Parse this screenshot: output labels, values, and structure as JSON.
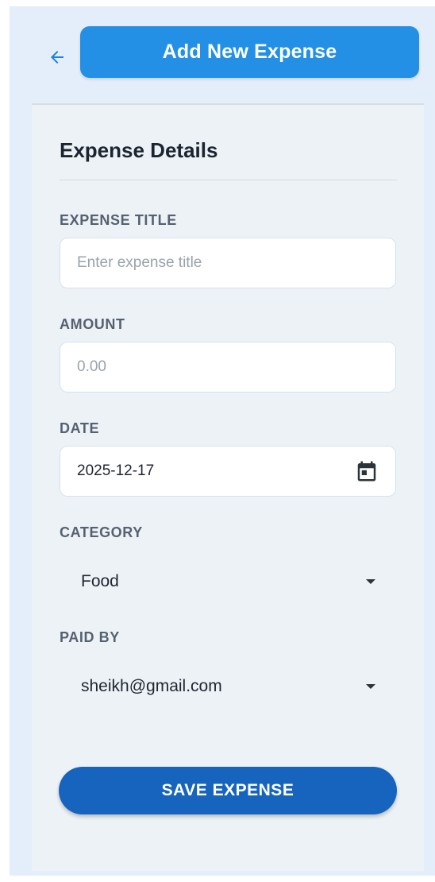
{
  "header": {
    "back_icon": "arrow-left-icon",
    "title": "Add New Expense"
  },
  "form": {
    "section_title": "Expense Details",
    "title_label": "EXPENSE TITLE",
    "title_placeholder": "Enter expense title",
    "amount_label": "AMOUNT",
    "amount_placeholder": "0.00",
    "date_label": "DATE",
    "date_value": "2025-12-17",
    "date_icon": "calendar-icon",
    "category_label": "CATEGORY",
    "category_value": "Food",
    "paid_by_label": "PAID BY",
    "paid_by_value": "sheikh@gmail.com",
    "dropdown_icon": "caret-down-icon",
    "save_label": "SAVE EXPENSE"
  },
  "colors": {
    "background": "#e3eefa",
    "accent": "#2390e6",
    "primary_button": "#1664be",
    "card": "#edf2f7"
  }
}
